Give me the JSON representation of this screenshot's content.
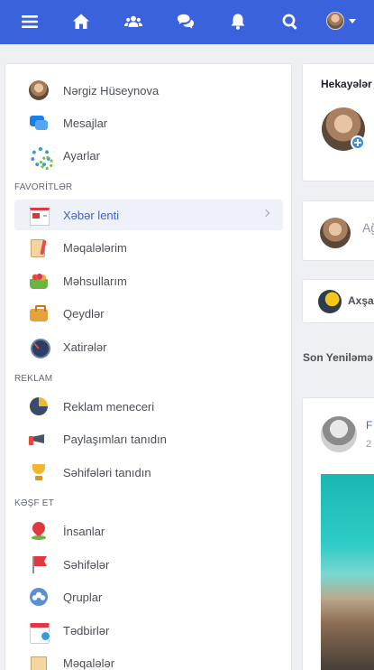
{
  "topbar": {
    "icons": [
      "menu-icon",
      "home-icon",
      "friends-icon",
      "messages-icon",
      "notifications-icon",
      "search-icon",
      "profile-avatar"
    ],
    "color": "#3b62dd"
  },
  "sidebar": {
    "profile": {
      "name": "Nərgiz Hüseynova",
      "icon": "avatar"
    },
    "top_items": [
      {
        "label": "Mesajlar",
        "icon": "chat-bubbles-icon"
      },
      {
        "label": "Ayarlar",
        "icon": "gears-icon"
      }
    ],
    "sections": [
      {
        "title": "FAVORİTLƏR",
        "items": [
          {
            "label": "Xəbər lenti",
            "icon": "newspaper-icon",
            "active": true
          },
          {
            "label": "Məqalələrim",
            "icon": "article-icon"
          },
          {
            "label": "Məhsullarım",
            "icon": "basket-icon"
          },
          {
            "label": "Qeydlər",
            "icon": "briefcase-icon"
          },
          {
            "label": "Xatirələr",
            "icon": "clock-icon"
          }
        ]
      },
      {
        "title": "REKLAM",
        "items": [
          {
            "label": "Reklam meneceri",
            "icon": "pie-chart-icon"
          },
          {
            "label": "Paylaşımları tanıdın",
            "icon": "megaphone-icon"
          },
          {
            "label": "Səhifələri tanıdın",
            "icon": "trophy-icon"
          }
        ]
      },
      {
        "title": "KƏŞF ET",
        "items": [
          {
            "label": "İnsanlar",
            "icon": "person-pin-icon"
          },
          {
            "label": "Səhifələr",
            "icon": "flag-icon"
          },
          {
            "label": "Qruplar",
            "icon": "group-globe-icon"
          },
          {
            "label": "Tədbirlər",
            "icon": "calendar-icon"
          },
          {
            "label": "Məqalələr",
            "icon": "article-icon"
          }
        ]
      }
    ]
  },
  "main": {
    "stories_title": "Hekayələr",
    "post_box_placeholder": "Ağ",
    "weather_text": "Axşa",
    "latest_label": "Son Yeniləmə",
    "post": {
      "author": "F",
      "time": "2"
    }
  }
}
